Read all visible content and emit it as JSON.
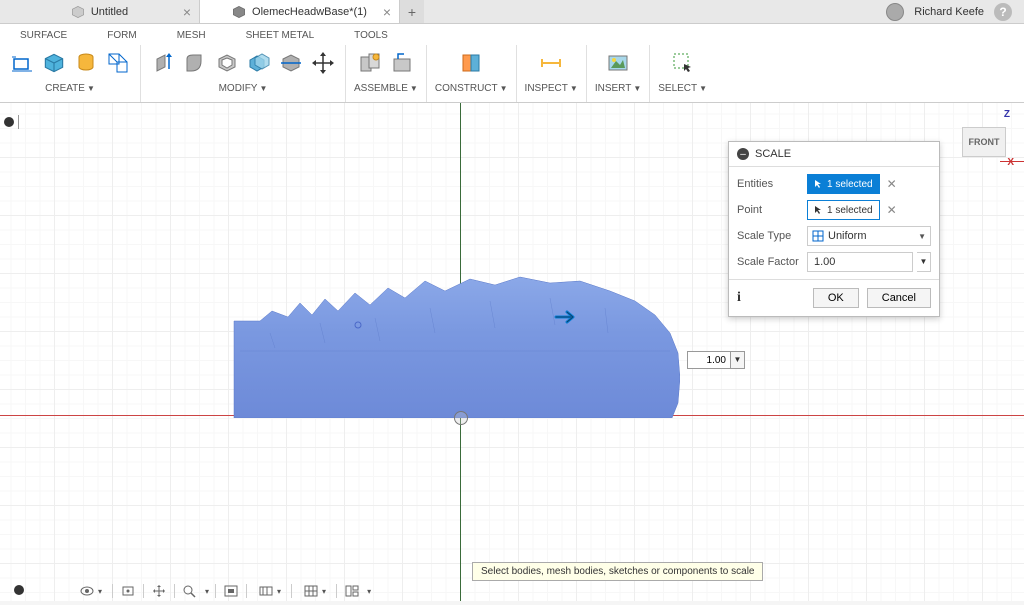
{
  "tabs": {
    "inactive": "Untitled",
    "active": "OlemecHeadwBase*(1)"
  },
  "user": {
    "name": "Richard Keefe"
  },
  "ribbon": {
    "surface": "SURFACE",
    "form": "FORM",
    "mesh": "MESH",
    "sheet_metal": "SHEET METAL",
    "tools": "TOOLS"
  },
  "groups": {
    "create": "CREATE",
    "modify": "MODIFY",
    "assemble": "ASSEMBLE",
    "construct": "CONSTRUCT",
    "inspect": "INSPECT",
    "insert": "INSERT",
    "select": "SELECT"
  },
  "view_cube": {
    "face": "FRONT",
    "z": "Z",
    "x": "X"
  },
  "dialog": {
    "title": "SCALE",
    "entities_label": "Entities",
    "entities_value": "1 selected",
    "point_label": "Point",
    "point_value": "1 selected",
    "scale_type_label": "Scale Type",
    "scale_type_value": "Uniform",
    "scale_factor_label": "Scale Factor",
    "scale_factor_value": "1.00",
    "ok": "OK",
    "cancel": "Cancel"
  },
  "inline_value": "1.00",
  "hint": "Select bodies, mesh bodies, sketches or components to scale"
}
